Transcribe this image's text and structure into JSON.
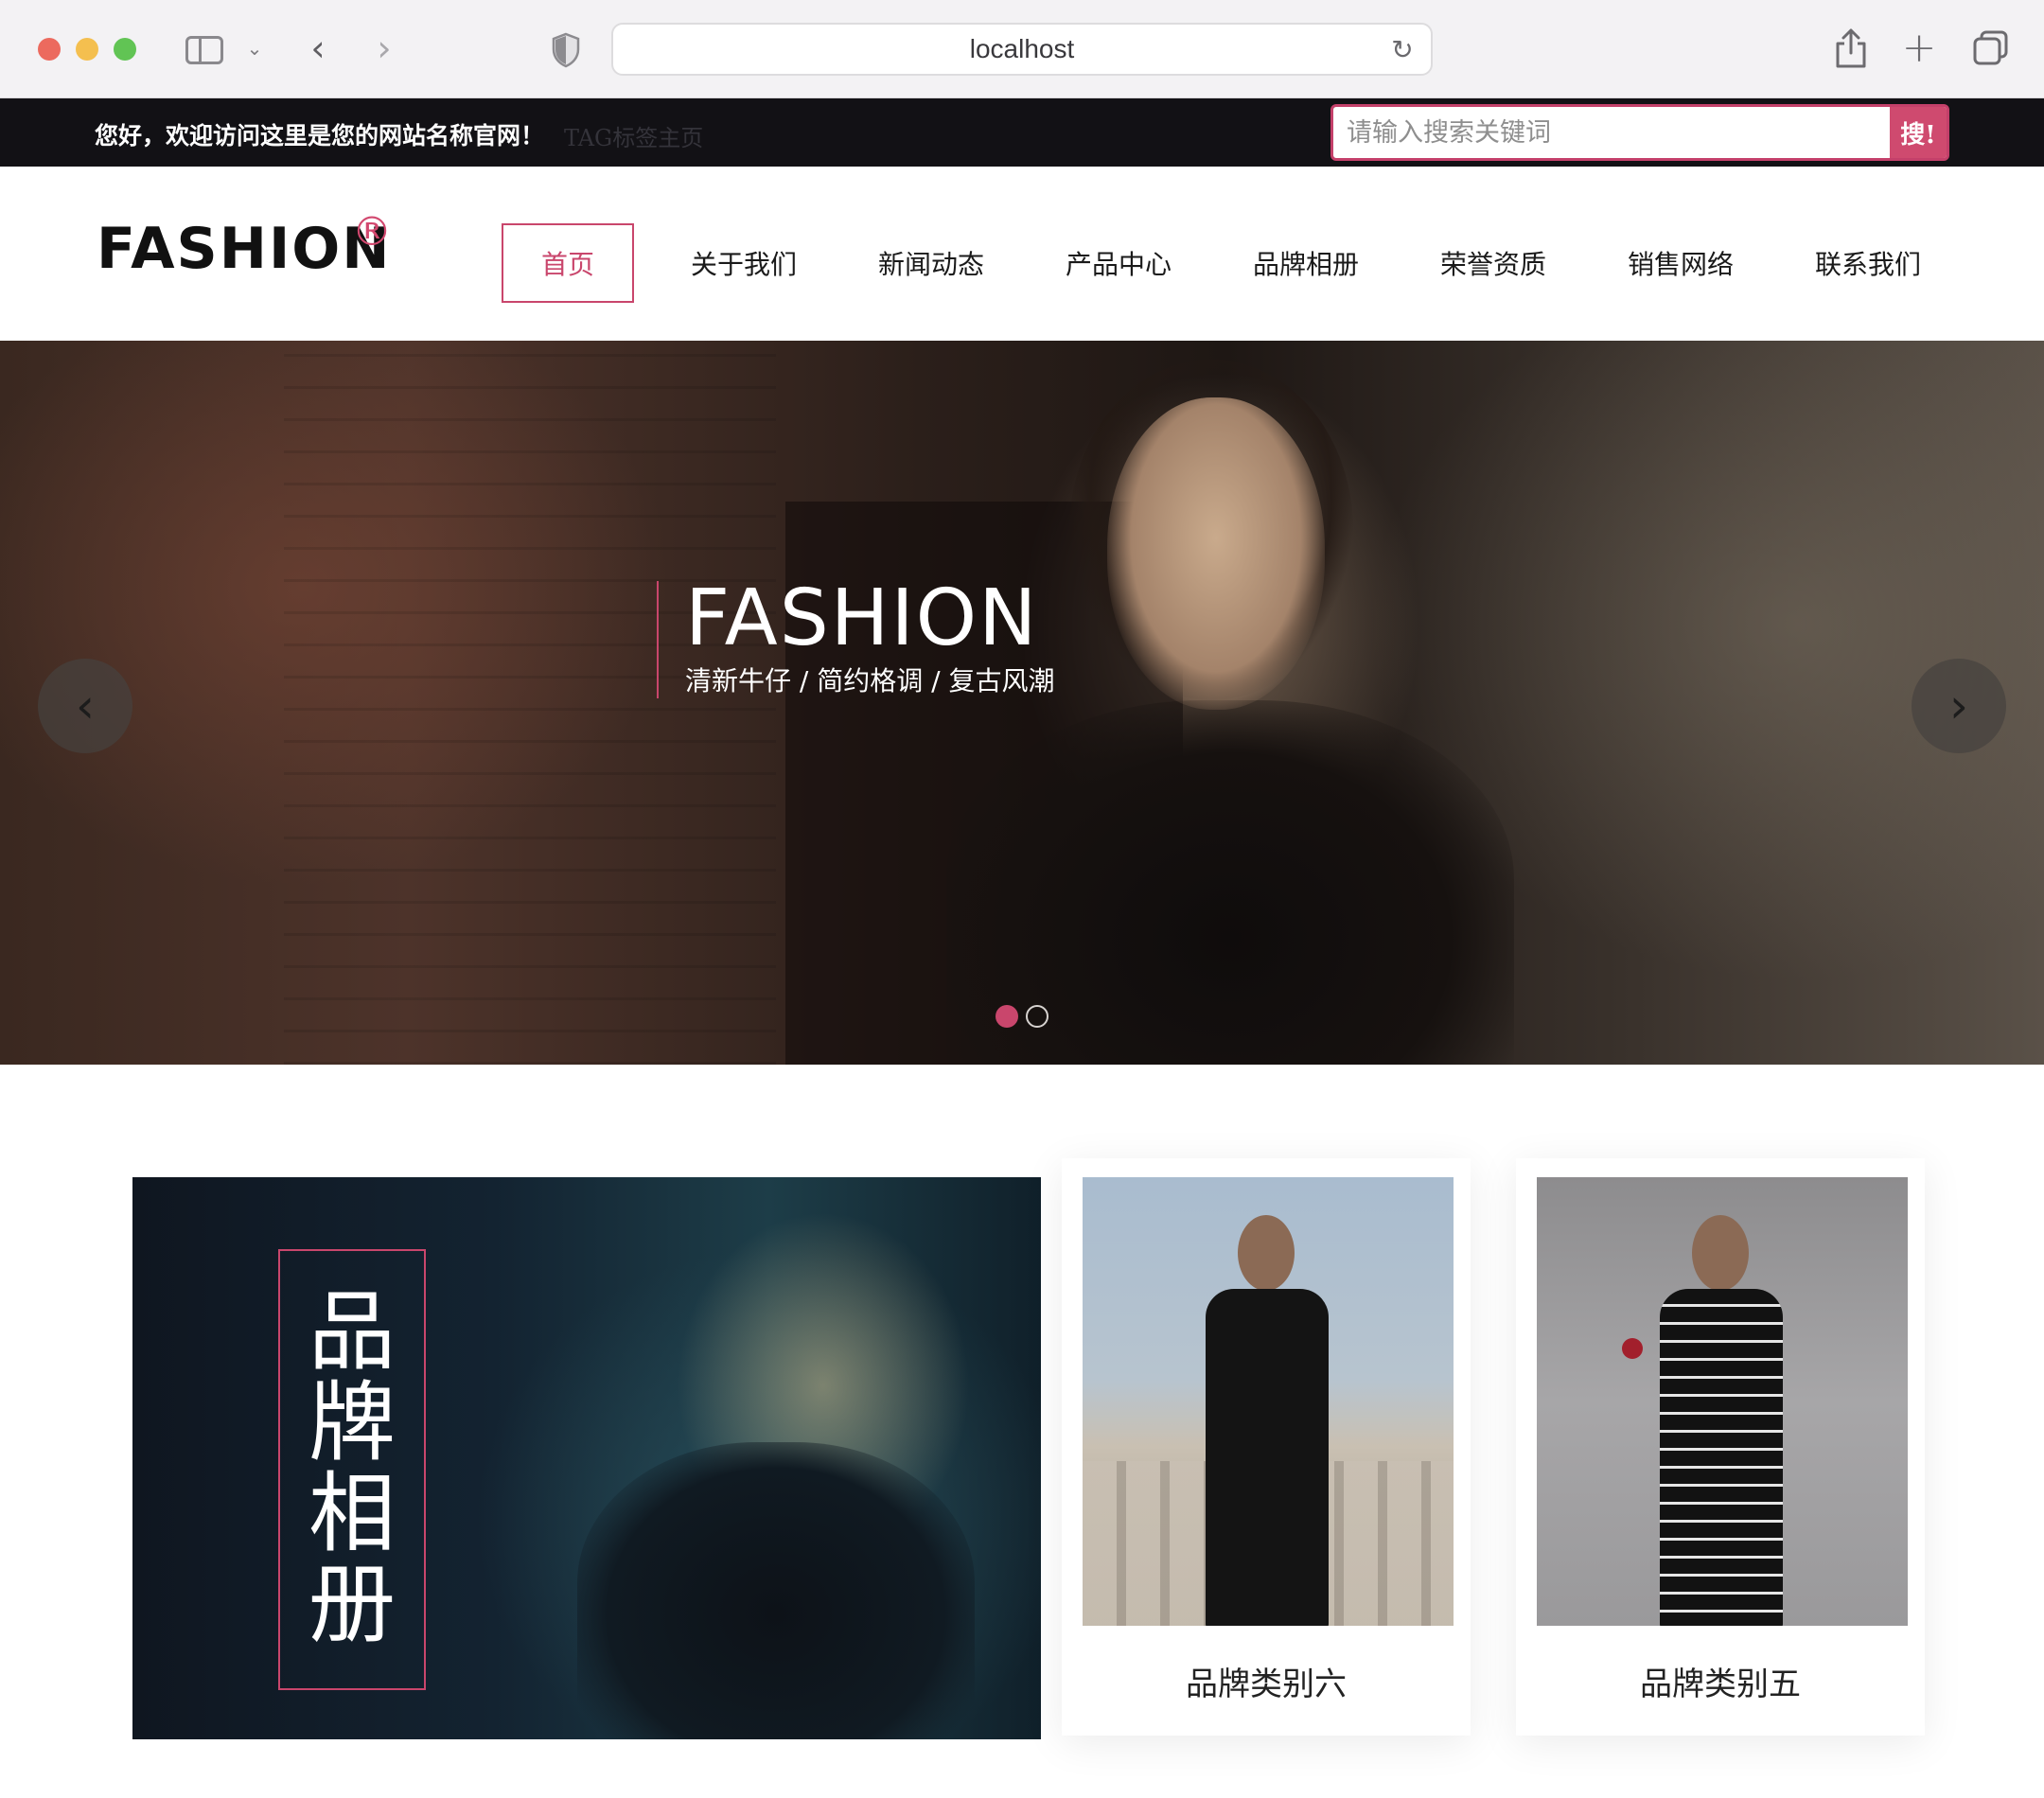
{
  "browser": {
    "url": "localhost"
  },
  "topbar": {
    "welcome": "您好，欢迎访问这里是您的网站名称官网！",
    "tag_link": "TAG标签主页",
    "search_placeholder": "请输入搜索关键词",
    "search_button": "搜!"
  },
  "header": {
    "logo": "FASHION",
    "logo_mark": "®"
  },
  "nav": {
    "items": [
      {
        "label": "首页",
        "active": true
      },
      {
        "label": "关于我们"
      },
      {
        "label": "新闻动态"
      },
      {
        "label": "产品中心"
      },
      {
        "label": "品牌相册"
      },
      {
        "label": "荣誉资质"
      },
      {
        "label": "销售网络"
      },
      {
        "label": "联系我们"
      }
    ]
  },
  "hero": {
    "title": "FASHION",
    "subtitle": "清新牛仔 / 简约格调 / 复古风潮",
    "slide_count": 2,
    "active_slide": 1
  },
  "album": {
    "title": "品牌相册",
    "cards": [
      {
        "label": "品牌类别六"
      },
      {
        "label": "品牌类别五"
      }
    ]
  },
  "colors": {
    "accent": "#c9466c",
    "topbar_bg": "#121115",
    "search_button_bg": "#cf4a6f"
  },
  "icons": {
    "prev": "chevron-left-icon",
    "next": "chevron-right-icon",
    "reload": "reload-icon",
    "share": "share-icon",
    "new_tab": "plus-icon",
    "tabs": "tab-overview-icon",
    "privacy": "shield-icon",
    "sidebar": "sidebar-icon"
  }
}
